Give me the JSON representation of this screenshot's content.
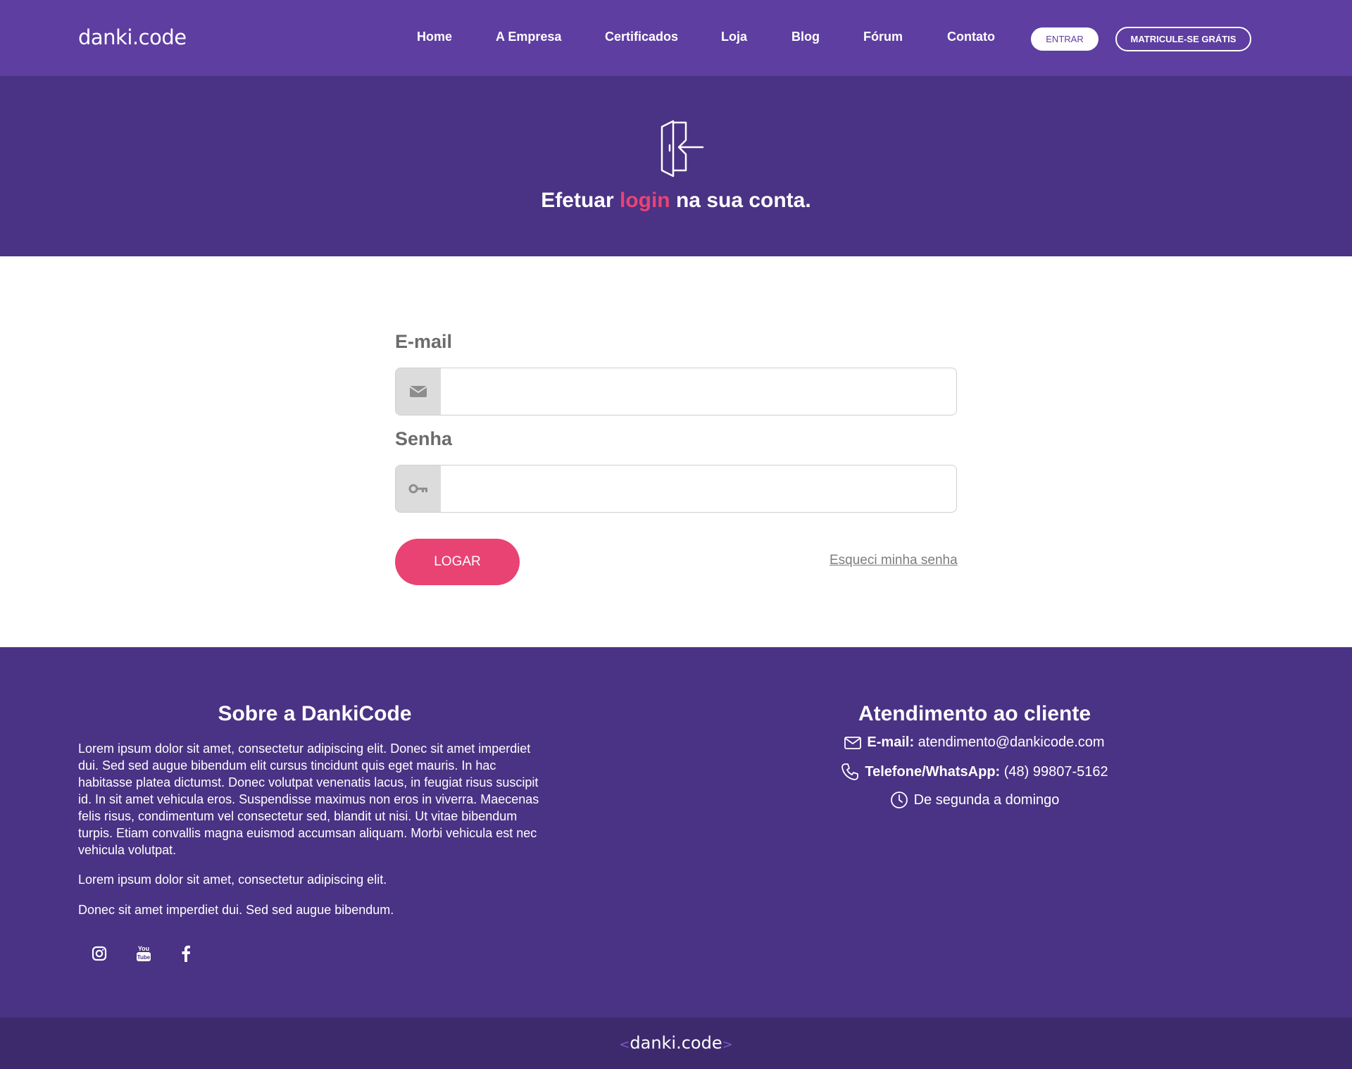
{
  "header": {
    "logo": "danki.code",
    "nav": [
      "Home",
      "A Empresa",
      "Certificados",
      "Loja",
      "Blog",
      "Fórum",
      "Contato"
    ],
    "entrar": "ENTRAR",
    "matricule": "MATRICULE-SE GRÁTIS"
  },
  "hero": {
    "title_pre": "Efetuar ",
    "title_highlight": "login",
    "title_post": " na sua conta."
  },
  "form": {
    "email_label": "E-mail",
    "email_value": "",
    "password_label": "Senha",
    "password_value": "",
    "submit": "LOGAR",
    "forgot": "Esqueci minha senha"
  },
  "footer": {
    "about_title": "Sobre a DankiCode",
    "about_p1": "Lorem ipsum dolor sit amet, consectetur adipiscing elit. Donec sit amet imperdiet dui. Sed sed augue bibendum elit cursus tincidunt quis eget mauris. In hac habitasse platea dictumst. Donec volutpat venenatis lacus, in feugiat risus suscipit id. In sit amet vehicula eros. Suspendisse maximus non eros in viverra. Maecenas felis risus, condimentum vel consectetur sed, blandit ut nisi. Ut vitae bibendum turpis. Etiam convallis magna euismod accumsan aliquam. Morbi vehicula est nec vehicula volutpat.",
    "about_p2": "Lorem ipsum dolor sit amet, consectetur adipiscing elit.",
    "about_p3": "Donec sit amet imperdiet dui. Sed sed augue bibendum.",
    "support_title": "Atendimento ao cliente",
    "email_label": "E-mail:",
    "email_value": "atendimento@dankicode.com",
    "phone_label": "Telefone/WhatsApp:",
    "phone_value": "(48) 99807-5162",
    "hours": "De segunda a domingo",
    "social_icons": [
      "instagram-icon",
      "youtube-icon",
      "facebook-icon"
    ]
  },
  "bottom": {
    "logo": "danki.code"
  },
  "colors": {
    "header_bg": "#5e3ea1",
    "hero_bg": "#4a3284",
    "accent": "#e94374",
    "bottom_bg": "#3d2a6d"
  }
}
